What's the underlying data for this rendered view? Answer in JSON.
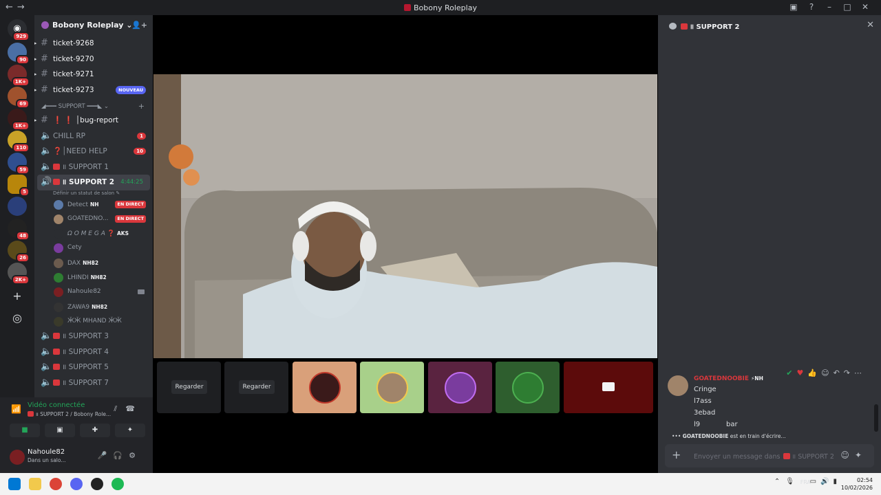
{
  "window": {
    "title": "Bobony Roleplay"
  },
  "servers": {
    "badges": [
      "929",
      "90",
      "1K+",
      "69",
      "1K+",
      "110",
      "59",
      "5",
      "48",
      "26",
      "2K+"
    ]
  },
  "guild": {
    "name": "Bobony Roleplay"
  },
  "channels": {
    "tickets": [
      {
        "label": "ticket-9268"
      },
      {
        "label": "ticket-9270"
      },
      {
        "label": "ticket-9271"
      },
      {
        "label": "ticket-9273",
        "tag": "NOUVEAU"
      }
    ],
    "category": "SUPPORT",
    "bug_report": "bug-report",
    "chill": {
      "label": "CHILL RP",
      "count": "1"
    },
    "need_help": {
      "label": "NEED HELP",
      "count": "10"
    },
    "support1": "SUPPORT 1",
    "support2": {
      "label": "SUPPORT 2",
      "timer": "4:44:25",
      "status": "Définir un statut de salon"
    },
    "voice_users": [
      {
        "name": "Detect",
        "nh": "NH",
        "live": "EN DIRECT",
        "color": "#5b7aa8"
      },
      {
        "name": "GOATEDNO...",
        "live": "EN DIRECT",
        "color": "#a0846a"
      },
      {
        "name": "Ω O M E G A",
        "nh": "AKS",
        "color": "#2b2d31"
      },
      {
        "name": "Cety",
        "color": "#7a3c9e"
      },
      {
        "name": "DAX",
        "nh": "NH82",
        "color": "#6b5b4e"
      },
      {
        "name": "LHINDI",
        "nh": "NH82",
        "color": "#2e7d32"
      },
      {
        "name": "Nahoule82",
        "cam": true,
        "color": "#7a1f22"
      },
      {
        "name": "ZAWA9",
        "nh": "NH82",
        "color": "#333333"
      },
      {
        "name": "ӁӁ MHAND ӁӁ",
        "color": "#3a3a2a"
      }
    ],
    "support3": "SUPPORT 3",
    "support4": "SUPPORT 4",
    "support5": "SUPPORT 5",
    "support7": "SUPPORT 7"
  },
  "voice_panel": {
    "status": "Vidéo connectée",
    "location": "SUPPORT 2 / Bobony Role...",
    "username": "Nahoule82",
    "sub": "Dans un salo..."
  },
  "stage": {
    "tiles": [
      {
        "label": "Regarder"
      },
      {
        "label": "Regarder"
      }
    ]
  },
  "sidebar": {
    "header": "SUPPORT 2",
    "author": "GOATEDNOOBIE",
    "author_tag": "NH",
    "messages": [
      "Cringe",
      "l7ass",
      "3ebad",
      "l9",
      "bar"
    ],
    "typing_user": "GOATEDNOOBIE",
    "typing_text": "est en train d'écrire...",
    "composer_placeholder_prefix": "Envoyer un message dans",
    "composer_channel": "SUPPORT 2"
  },
  "taskbar": {
    "lang": "FRA",
    "time": "02:54",
    "date": "10/02/2026"
  },
  "colors": {
    "accent_red": "#da373c",
    "online_green": "#23a559",
    "blurple": "#5865f2"
  }
}
